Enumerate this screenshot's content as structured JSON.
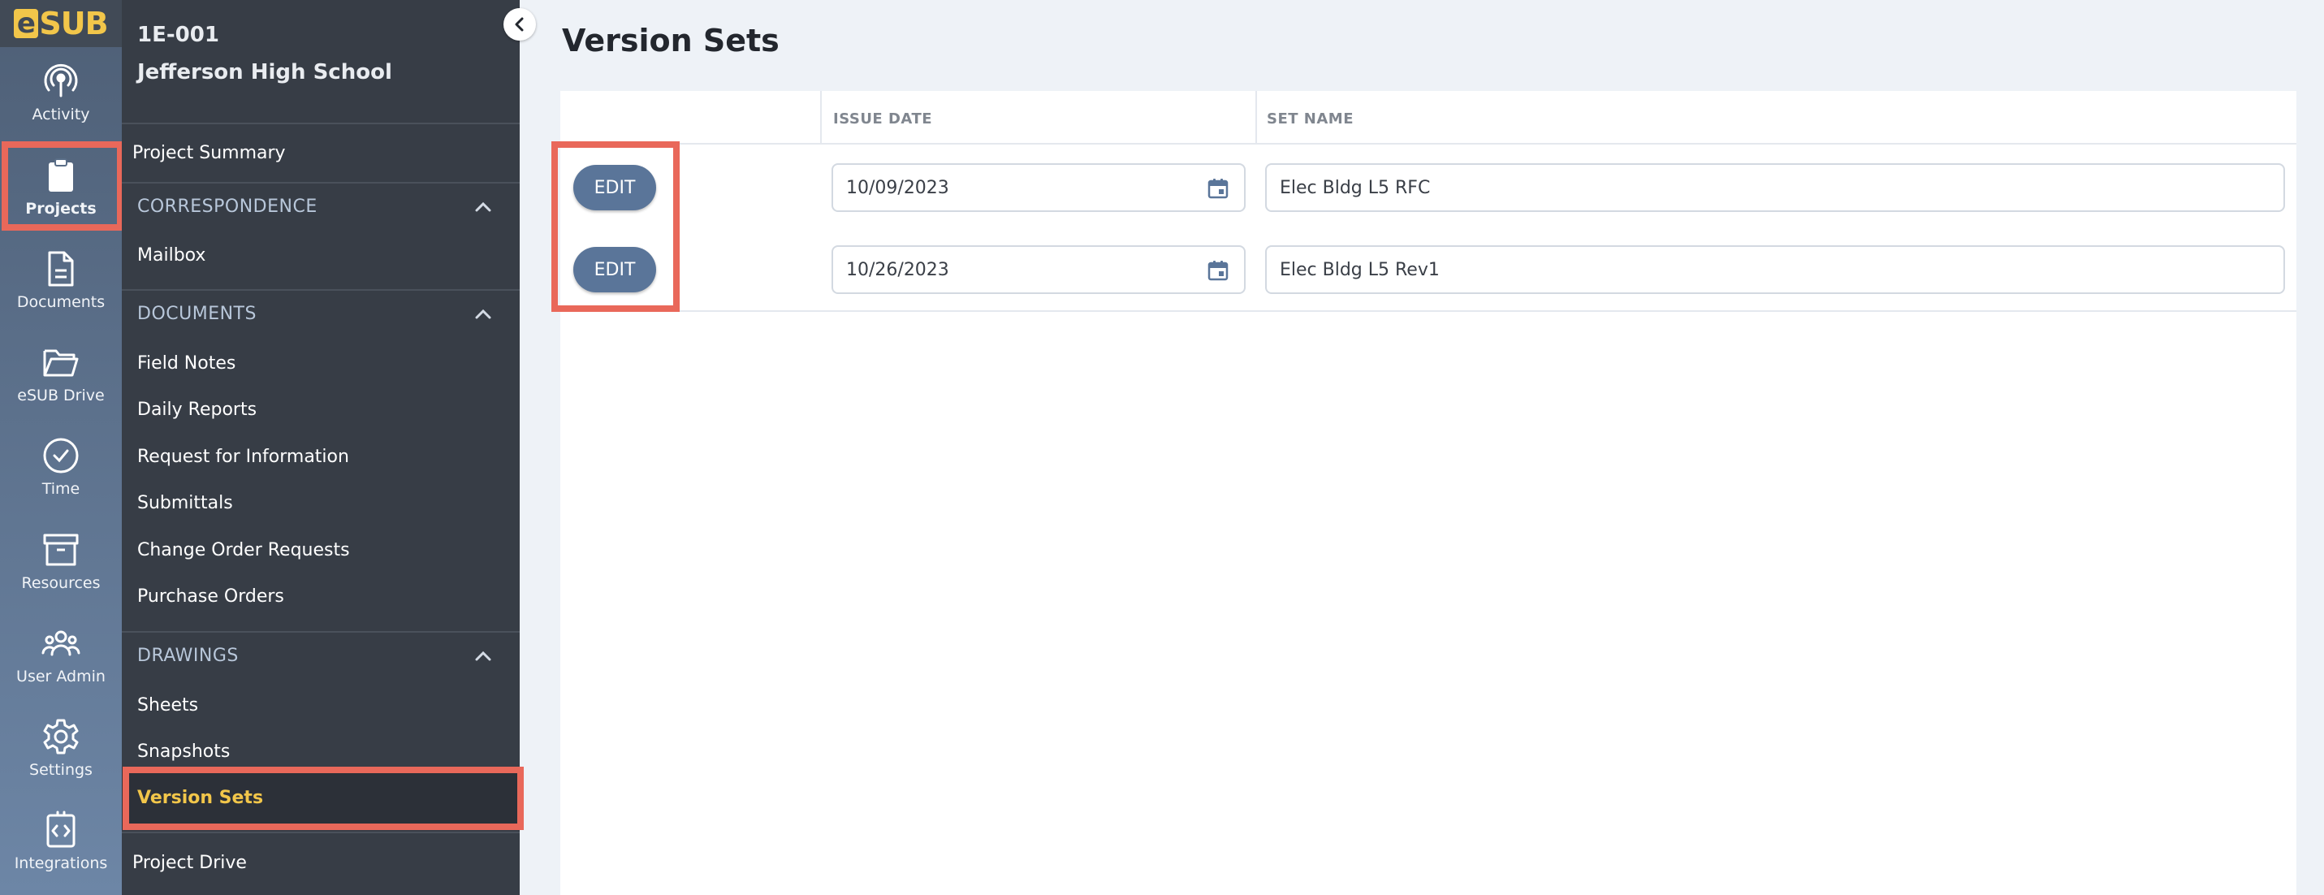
{
  "app": {
    "logo_prefix": "e",
    "logo_suffix": "SUB"
  },
  "rail": {
    "items": [
      {
        "label": "Activity",
        "icon": "activity-icon"
      },
      {
        "label": "Projects",
        "icon": "clipboard-icon"
      },
      {
        "label": "Documents",
        "icon": "document-icon"
      },
      {
        "label": "eSUB Drive",
        "icon": "folder-icon"
      },
      {
        "label": "Time",
        "icon": "clock-icon"
      },
      {
        "label": "Resources",
        "icon": "archive-icon"
      },
      {
        "label": "User Admin",
        "icon": "users-icon"
      },
      {
        "label": "Settings",
        "icon": "gear-icon"
      },
      {
        "label": "Integrations",
        "icon": "code-icon"
      }
    ],
    "active": "Projects"
  },
  "nav": {
    "project_code": "1E-001",
    "project_name": "Jefferson High School",
    "project_summary": "Project Summary",
    "correspondence": {
      "title": "CORRESPONDENCE",
      "items": [
        "Mailbox"
      ]
    },
    "documents": {
      "title": "DOCUMENTS",
      "items": [
        "Field Notes",
        "Daily Reports",
        "Request for Information",
        "Submittals",
        "Change Order Requests",
        "Purchase Orders"
      ]
    },
    "drawings": {
      "title": "DRAWINGS",
      "items": [
        "Sheets",
        "Snapshots",
        "Version Sets"
      ]
    },
    "project_drive": "Project Drive"
  },
  "main": {
    "title": "Version Sets",
    "table": {
      "columns": [
        "",
        "ISSUE DATE",
        "SET NAME"
      ],
      "rows": [
        {
          "action": "EDIT",
          "issue_date": "10/09/2023",
          "set_name": "Elec Bldg L5 RFC"
        },
        {
          "action": "EDIT",
          "issue_date": "10/26/2023",
          "set_name": "Elec Bldg L5 Rev1"
        }
      ]
    }
  },
  "colors": {
    "accent": "#f2c64a",
    "highlight": "#e9685a",
    "button": "#5a7599",
    "nav_bg": "#373d46"
  }
}
